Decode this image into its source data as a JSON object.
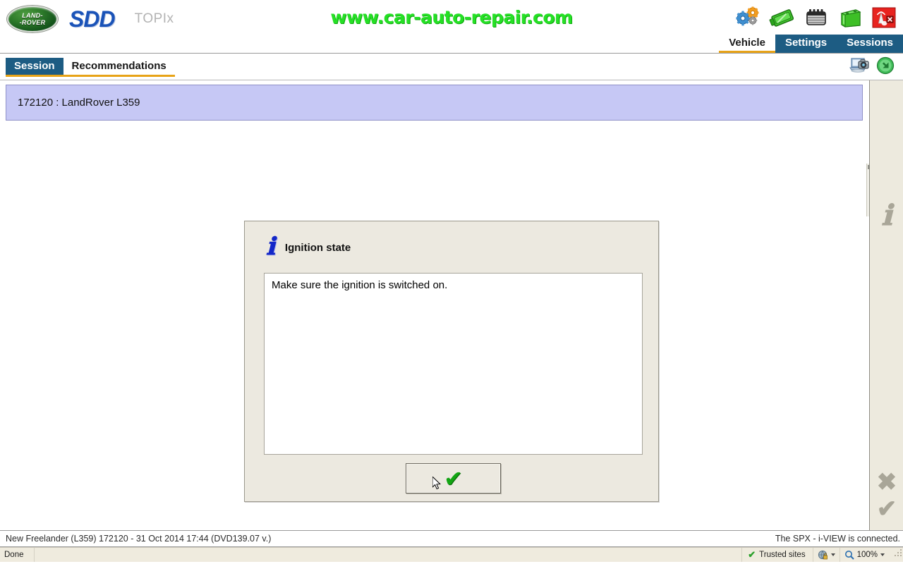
{
  "header": {
    "logo_line1": "LAND-",
    "logo_line2": "-ROVER",
    "product": "SDD",
    "subproduct": "TOPIx",
    "watermark": "www.car-auto-repair.com",
    "icons": [
      {
        "name": "gears-icon",
        "title": "Settings / configuration"
      },
      {
        "name": "connector-cable-icon",
        "title": "Vehicle connector"
      },
      {
        "name": "ecu-module-icon",
        "title": "Control module"
      },
      {
        "name": "battery-icon",
        "title": "Battery status"
      },
      {
        "name": "wireless-disconnected-icon",
        "title": "Wireless disconnected"
      }
    ],
    "tabs": [
      {
        "label": "Vehicle",
        "active": true
      },
      {
        "label": "Settings",
        "active": false
      },
      {
        "label": "Sessions",
        "active": false
      }
    ]
  },
  "subbar": {
    "tabs": [
      {
        "label": "Session",
        "active": true
      },
      {
        "label": "Recommendations",
        "active": false
      }
    ],
    "icons": [
      {
        "name": "screenshot-camera-icon"
      },
      {
        "name": "green-back-arrow-icon"
      }
    ]
  },
  "session": {
    "banner": "172120 : LandRover L359"
  },
  "dialog": {
    "icon": "info-icon",
    "title": "Ignition state",
    "message": "Make sure the ignition is switched on.",
    "ok_icon": "green-check-icon",
    "ok_label": "✔"
  },
  "right_rail": {
    "items": [
      {
        "name": "info-icon",
        "glyph": "ı",
        "enabled": false
      },
      {
        "name": "cancel-x-icon",
        "glyph": "✖",
        "enabled": false
      },
      {
        "name": "confirm-check-icon",
        "glyph": "✔",
        "enabled": false
      }
    ]
  },
  "status_app": {
    "left": "New Freelander (L359) 172120 - 31 Oct 2014 17:44 (DVD139.07 v.)",
    "right": "The SPX - i-VIEW is connected."
  },
  "status_browser": {
    "done": "Done",
    "zone": "Trusted sites",
    "zone_icon": "green-check-icon",
    "protected_icon": "internet-zone-icon",
    "zoom_icon": "magnifier-icon",
    "zoom_level": "100%"
  },
  "colors": {
    "accent_blue": "#1d5c83",
    "accent_orange": "#e8a317",
    "banner_purple": "#c6c8f5",
    "dialog_bg": "#ece9e0",
    "watermark_green": "#25e025",
    "check_green": "#13a513"
  }
}
